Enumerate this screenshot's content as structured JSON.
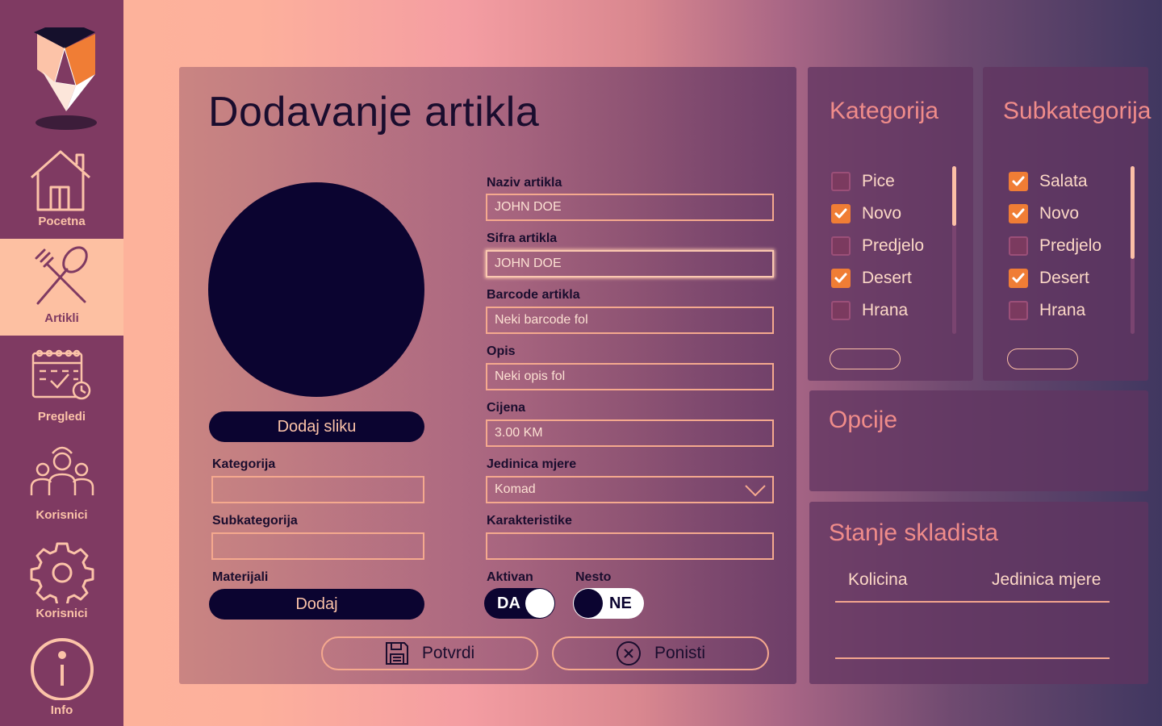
{
  "sidebar": {
    "items": [
      {
        "label": "Pocetna",
        "icon": "home-icon"
      },
      {
        "label": "Artikli",
        "icon": "fork-spoon-icon",
        "active": true
      },
      {
        "label": "Pregledi",
        "icon": "calendar-icon"
      },
      {
        "label": "Korisnici",
        "icon": "users-icon"
      },
      {
        "label": "Korisnici",
        "icon": "gear-icon"
      },
      {
        "label": "Info",
        "icon": "info-icon"
      }
    ]
  },
  "main": {
    "title": "Dodavanje artikla",
    "add_image_label": "Dodaj sliku",
    "left_fields": {
      "kategorija_label": "Kategorija",
      "kategorija_value": "",
      "subkategorija_label": "Subkategorija",
      "subkategorija_value": "",
      "materijali_label": "Materijali",
      "materijali_button": "Dodaj"
    },
    "fields": {
      "naziv_label": "Naziv artikla",
      "naziv_value": "JOHN DOE",
      "sifra_label": "Sifra artikla",
      "sifra_value": "JOHN DOE",
      "barcode_label": "Barcode artikla",
      "barcode_value": "Neki barcode fol",
      "opis_label": "Opis",
      "opis_value": "Neki opis fol",
      "cijena_label": "Cijena",
      "cijena_value": "3.00 KM",
      "jedinica_label": "Jedinica mjere",
      "jedinica_value": "Komad",
      "karakteristike_label": "Karakteristike",
      "karakteristike_value": ""
    },
    "toggles": {
      "aktivan_label": "Aktivan",
      "aktivan_value": "DA",
      "nesto_label": "Nesto",
      "nesto_value": "NE"
    },
    "buttons": {
      "confirm": "Potvrdi",
      "cancel": "Ponisti"
    }
  },
  "kategorija_panel": {
    "title": "Kategorija",
    "items": [
      {
        "label": "Pice",
        "checked": false
      },
      {
        "label": "Novo",
        "checked": true
      },
      {
        "label": "Predjelo",
        "checked": false
      },
      {
        "label": "Desert",
        "checked": true
      },
      {
        "label": "Hrana",
        "checked": false
      }
    ]
  },
  "subkategorija_panel": {
    "title": "Subkategorija",
    "items": [
      {
        "label": "Salata",
        "checked": true
      },
      {
        "label": "Novo",
        "checked": true
      },
      {
        "label": "Predjelo",
        "checked": false
      },
      {
        "label": "Desert",
        "checked": true
      },
      {
        "label": "Hrana",
        "checked": false
      }
    ]
  },
  "opcije_panel": {
    "title": "Opcije"
  },
  "stanje_panel": {
    "title": "Stanje skladista",
    "columns": [
      "Kolicina",
      "Jedinica mjere"
    ]
  },
  "colors": {
    "sidebar": "#7f3a62",
    "accent": "#f07d35",
    "dark": "#0b0430",
    "peach": "#fcc3a8",
    "panel_title": "#f08c8a"
  }
}
